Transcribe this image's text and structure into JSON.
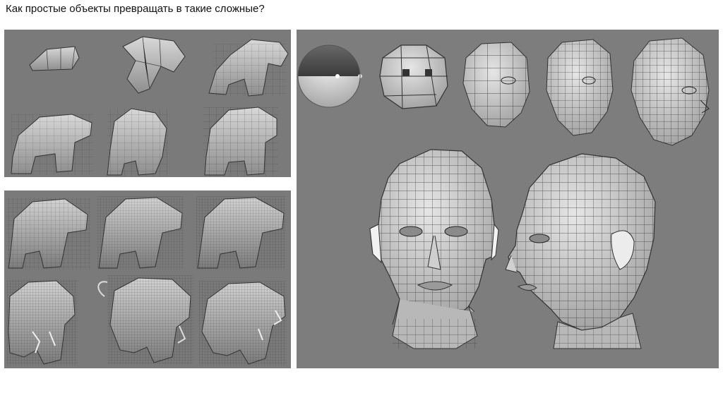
{
  "slide": {
    "title": "Как простые объекты превращать в такие сложные?"
  },
  "colors": {
    "panel_bg": "#7a7a7a",
    "model_light": "#d4d4d4",
    "model_mid": "#a9a9a9",
    "model_dark": "#5f5f5f",
    "wire": "#3a3a3a"
  },
  "panels": [
    {
      "name": "creature-blocking-stages",
      "stage_count": 6
    },
    {
      "name": "creature-detailing-stages",
      "stage_count": 6
    },
    {
      "name": "head-modeling-stages",
      "stage_count": 7
    }
  ]
}
